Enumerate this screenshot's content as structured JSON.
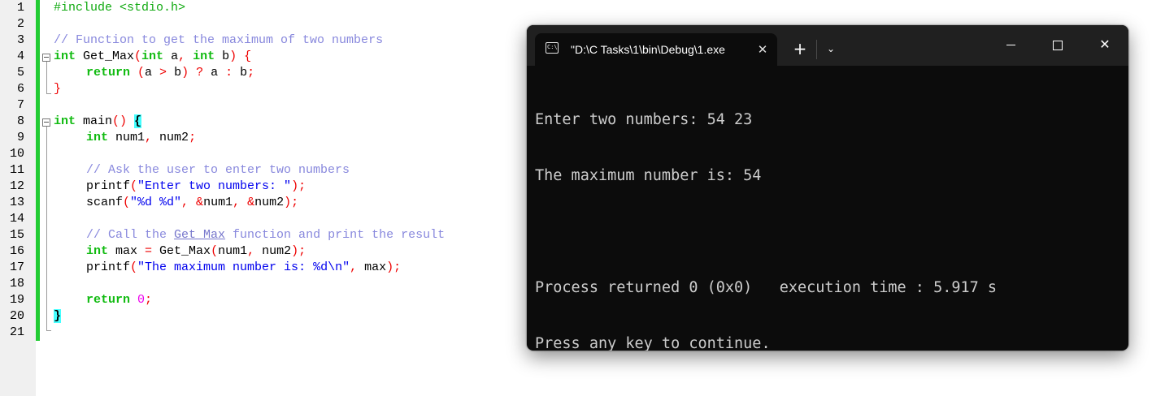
{
  "editor": {
    "line_numbers": [
      "1",
      "2",
      "3",
      "4",
      "5",
      "6",
      "7",
      "8",
      "9",
      "10",
      "11",
      "12",
      "13",
      "14",
      "15",
      "16",
      "17",
      "18",
      "19",
      "20",
      "21"
    ],
    "code": {
      "l1_include": "#include <stdio.h>",
      "l3_comment": "// Function to get the maximum of two numbers",
      "l4_int": "int",
      "l4_name": " Get_Max",
      "l4_paren_open": "(",
      "l4_int_a": "int",
      "l4_a": " a",
      "l4_comma": ",",
      "l4_int_b": " int",
      "l4_b": " b",
      "l4_close": ") {",
      "l5_return": "return",
      "l5_cond_open": " (",
      "l5_a": "a",
      "l5_gt": " > ",
      "l5_b": "b",
      "l5_q": ") ? ",
      "l5_a2": "a",
      "l5_colon": " : ",
      "l5_b2": "b",
      "l5_semi": ";",
      "l6_brace": "}",
      "l8_int": "int",
      "l8_main": " main",
      "l8_parens": "() ",
      "l8_brace": "{",
      "l9_int": "int",
      "l9_vars": " num1",
      "l9_comma": ",",
      "l9_num2": " num2",
      "l9_semi": ";",
      "l11_comment": "// Ask the user to enter two numbers",
      "l12_printf": "printf",
      "l12_open": "(",
      "l12_str": "\"Enter two numbers: \"",
      "l12_close": ");",
      "l13_scanf": "scanf",
      "l13_open": "(",
      "l13_str": "\"%d %d\"",
      "l13_sep1": ", &",
      "l13_num1": "num1",
      "l13_sep2": ", &",
      "l13_num2": "num2",
      "l13_close": ");",
      "l15_comment_a": "// Call the ",
      "l15_comment_fn": "Get_Max",
      "l15_comment_b": " function and print the result",
      "l16_int": "int",
      "l16_max": " max ",
      "l16_eq": "=",
      "l16_call": " Get_Max",
      "l16_open": "(",
      "l16_num1": "num1",
      "l16_comma": ",",
      "l16_num2": " num2",
      "l16_close": ");",
      "l17_printf": "printf",
      "l17_open": "(",
      "l17_str": "\"The maximum number is: %d\\n\"",
      "l17_comma": ",",
      "l17_max": " max",
      "l17_close": ");",
      "l19_return": "return",
      "l19_zero": " 0",
      "l19_semi": ";",
      "l20_brace": "}"
    }
  },
  "console": {
    "tab_title": "\"D:\\C Tasks\\1\\bin\\Debug\\1.exe",
    "tab_icon_text": "C:\\",
    "close_tab_glyph": "✕",
    "new_tab_glyph": "+",
    "dropdown_glyph": "⌄",
    "close_window_glyph": "✕",
    "output": [
      "Enter two numbers: 54 23",
      "The maximum number is: 54",
      "",
      "Process returned 0 (0x0)   execution time : 5.917 s",
      "Press any key to continue."
    ]
  },
  "colors": {
    "keyword": "#11bb11",
    "comment": "#8888dd",
    "string": "#0000ee",
    "number": "#ee00ee",
    "operator": "#ee0000",
    "brace_highlight": "#44ffff",
    "console_bg": "#0c0c0c",
    "titlebar_bg": "#202020"
  }
}
